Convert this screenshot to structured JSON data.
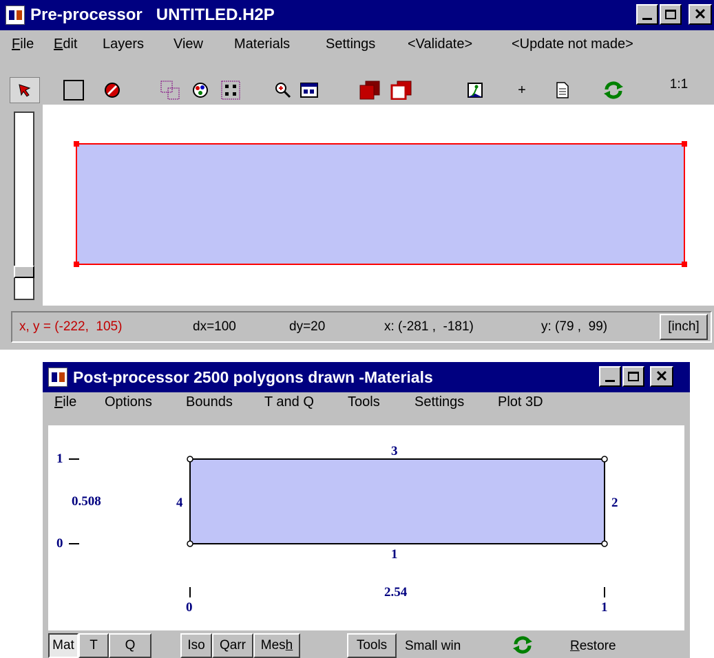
{
  "pre": {
    "title": "Pre-processor   UNTITLED.H2P",
    "menu": [
      {
        "label": "File",
        "u": "F",
        "rest": "ile"
      },
      {
        "label": "Edit",
        "u": "E",
        "rest": "dit"
      },
      {
        "label": "Layers"
      },
      {
        "label": "View"
      },
      {
        "label": "Materials"
      },
      {
        "label": "Settings"
      },
      {
        "label": "<Validate>"
      },
      {
        "label": "<Update not made>"
      }
    ],
    "zoom_label": "1:1",
    "status": {
      "xy": "x, y = (-222,  105)",
      "dx": "dx=100",
      "dy": "dy=20",
      "xrange": "x: (-281 ,  -181)",
      "yrange": "y: (79 ,  99)",
      "unit_button": "[inch]"
    },
    "colors": {
      "fill": "#c0c4f8",
      "outline": "#ff0000"
    }
  },
  "post": {
    "title": "Post-processor 2500 polygons drawn -Materials",
    "menu": [
      "Options",
      "Bounds",
      "T and Q",
      "Tools",
      "Settings",
      "Plot 3D"
    ],
    "file_u": "F",
    "file_rest": "ile",
    "axis": {
      "y_top": "1",
      "y_bottom": "0",
      "y_mid": "0.508",
      "x_left": "0",
      "x_right": "1",
      "x_mid": "2.54"
    },
    "edges": {
      "bottom": "1",
      "right": "2",
      "top": "3",
      "left": "4"
    },
    "buttons": {
      "mat": "Mat",
      "t": "T",
      "q": "Q",
      "iso": "Iso",
      "qarr": "Qarr",
      "mesh_pre": "Mes",
      "mesh_u": "h",
      "tools": "Tools"
    },
    "small_win": "Small win",
    "restore_u": "R",
    "restore_rest": "estore",
    "colors": {
      "fill": "#c0c4f8",
      "outline": "#000000"
    }
  }
}
